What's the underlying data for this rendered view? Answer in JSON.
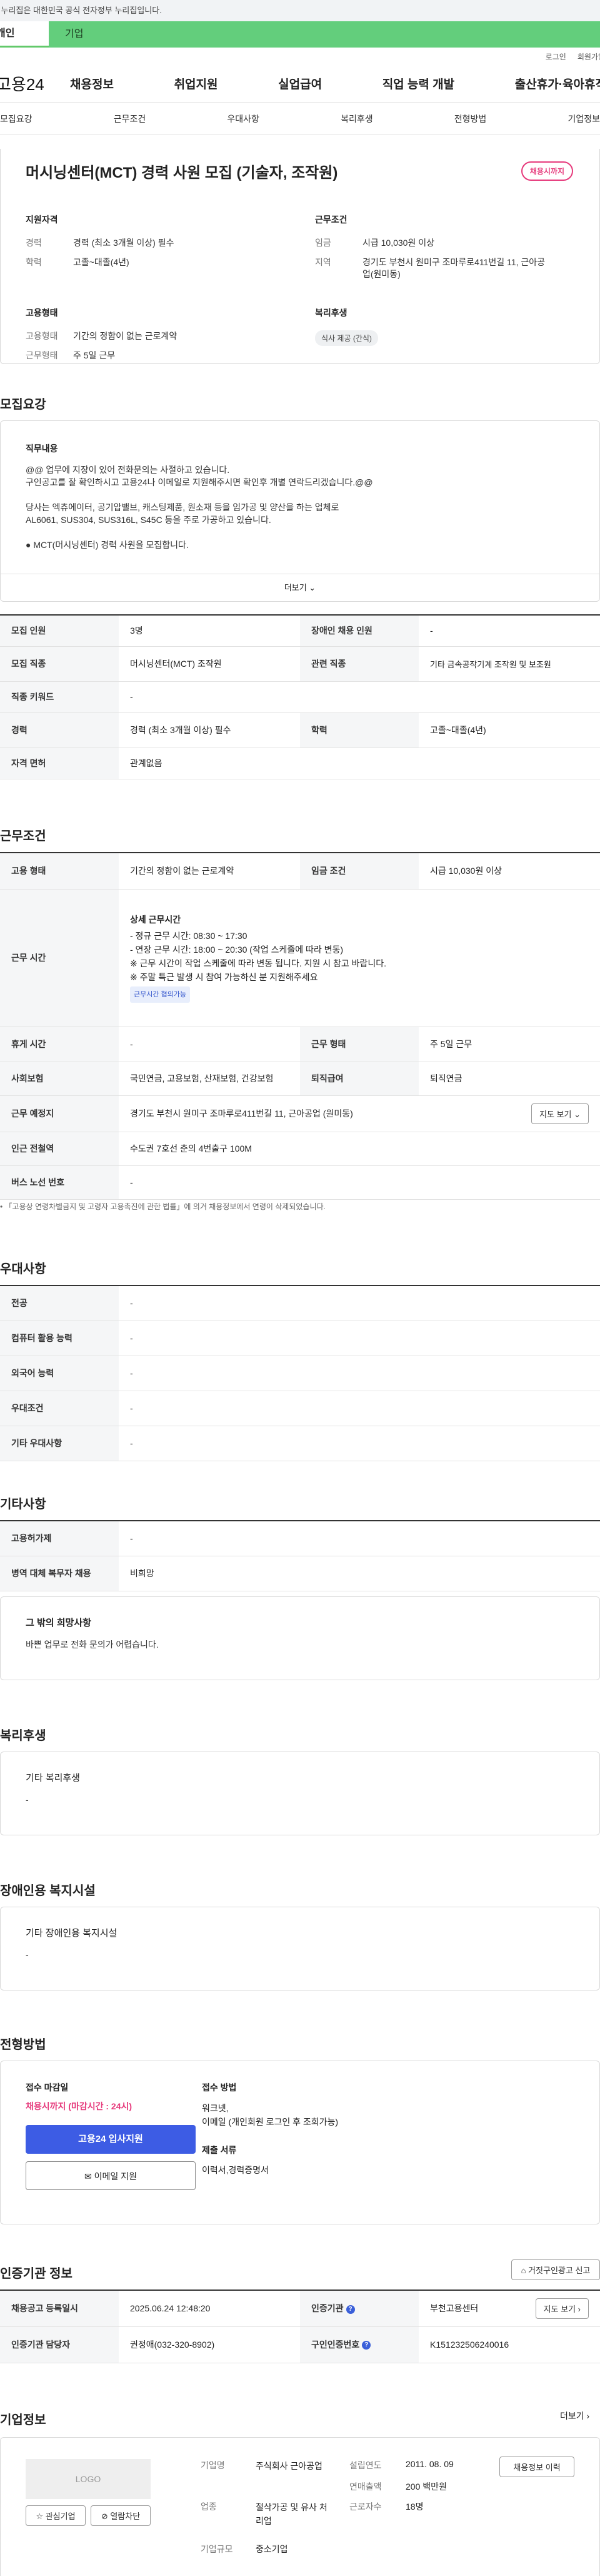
{
  "gov_banner": "이 누리집은 대한민국 공식 전자정부 누리집입니다.",
  "user_tabs": {
    "personal": "개인",
    "company": "기업"
  },
  "util": {
    "login": "로그인",
    "join": "회원가입"
  },
  "site": {
    "logo": "고용24"
  },
  "gnb": [
    "채용정보",
    "취업지원",
    "실업급여",
    "직업 능력 개발",
    "출산휴가·육아휴직"
  ],
  "anchors": [
    "모집요강",
    "근무조건",
    "우대사항",
    "복리후생",
    "전형방법",
    "기업정보"
  ],
  "job": {
    "title": "머시닝센터(MCT) 경력 사원 모집 (기술자, 조작원)",
    "status": "채용시까지",
    "qualification": {
      "heading": "지원자격",
      "career_label": "경력",
      "career": "경력 (최소 3개월 이상) 필수",
      "edu_label": "학력",
      "edu": "고졸~대졸(4년)"
    },
    "conditions": {
      "heading": "근무조건",
      "wage_label": "임금",
      "wage": "시급 10,030원 이상",
      "region_label": "지역",
      "region": "경기도 부천시 원미구 조마루로411번길 11, 근아공업(원미동)"
    },
    "employment": {
      "heading": "고용형태",
      "type_label": "고용형태",
      "type": "기간의 정함이 없는 근로계약",
      "schedule_label": "근무형태",
      "schedule": "주 5일 근무"
    },
    "welfare": {
      "heading": "복리후생",
      "chip": "식사 제공 (간식)"
    }
  },
  "recruit": {
    "heading": "모집요강",
    "duty_heading": "직무내용",
    "duty_lines": [
      "@@ 업무에 지장이 있어 전화문의는 사절하고 있습니다.",
      "구인공고를 잘 확인하시고 고용24나 이메일로 지원해주시면 확인후 개별 연락드리겠습니다.@@",
      "",
      "당사는 엑츄에이터, 공기압밸브, 캐스팅제품, 원소재 등을 임가공 및 양산을 하는 업체로",
      "AL6061, SUS304, SUS316L, S45C 등을 주로 가공하고 있습니다.",
      "",
      "● MCT(머시닝센터) 경력 사원을 모집합니다."
    ],
    "more": "더보기",
    "rows": [
      {
        "k1": "모집 인원",
        "v1": "3명",
        "k2": "장애인 채용 인원",
        "v2": "-"
      },
      {
        "k1": "모집 직종",
        "v1": "머시닝센터(MCT) 조작원",
        "k2": "관련 직종",
        "v2": "기타 금속공작기계 조작원 및 보조원"
      },
      {
        "k1": "직종 키워드",
        "v1": "-"
      },
      {
        "k1": "경력",
        "v1": "경력 (최소 3개월 이상) 필수",
        "k2": "학력",
        "v2": "고졸~대졸(4년)"
      },
      {
        "k1": "자격 면허",
        "v1": "관계없음"
      }
    ]
  },
  "work": {
    "heading": "근무조건",
    "type_k": "고용 형태",
    "type_v": "기간의 정함이 없는 근로계약",
    "wage_k": "임금 조건",
    "wage_v": "시급 10,030원 이상",
    "hours_k": "근무 시간",
    "hours_title": "상세 근무시간",
    "hours_lines": [
      "- 정규 근무 시간: 08:30 ~ 17:30",
      "- 연장 근무 시간: 18:00 ~ 20:30 (작업 스케줄에 따라 변동)",
      "※ 근무 시간이 작업 스케줄에 따라 변동 됩니다. 지원 시 참고 바랍니다.",
      "※ 주말 특근 발생 시 참여 가능하신 분 지원해주세요"
    ],
    "hours_badge": "근무시간 협의가능",
    "rest_k": "휴게 시간",
    "rest_v": "-",
    "form_k": "근무 형태",
    "form_v": "주 5일 근무",
    "ins_k": "사회보험",
    "ins_v": "국민연금, 고용보험, 산재보험, 건강보험",
    "ret_k": "퇴직급여",
    "ret_v": "퇴직연금",
    "place_k": "근무 예정지",
    "place_v": "경기도 부천시 원미구 조마루로411번길 11, 근아공업 (원미동)",
    "map_btn": "지도 보기",
    "subway_k": "인근 전철역",
    "subway_v": "수도권 7호선 춘의 4번출구 100M",
    "bus_k": "버스 노선 번호",
    "bus_v": "-",
    "note": "「고용상 연령차별금지 및 고령자 고용촉진에 관한 법률」에 의거 채용정보에서 연령이 삭제되었습니다."
  },
  "pref": {
    "heading": "우대사항",
    "rows": [
      {
        "k": "전공",
        "v": "-"
      },
      {
        "k": "컴퓨터 활용 능력",
        "v": "-"
      },
      {
        "k": "외국어 능력",
        "v": "-"
      },
      {
        "k": "우대조건",
        "v": "-"
      },
      {
        "k": "기타 우대사항",
        "v": "-"
      }
    ]
  },
  "etc": {
    "heading": "기타사항",
    "rows": [
      {
        "k": "고용허가제",
        "v": "-"
      },
      {
        "k": "병역 대체 복무자 채용",
        "v": "비희망"
      }
    ],
    "wish_heading": "그 밖의 희망사항",
    "wish": "바쁜 업무로 전화 문의가 어렵습니다."
  },
  "benefits": {
    "heading": "복리후생",
    "sub": "기타 복리후생",
    "value": "-"
  },
  "disability": {
    "heading": "장애인용 복지시설",
    "sub": "기타 장애인용 복지시설",
    "value": "-"
  },
  "process": {
    "heading": "전형방법",
    "deadline_label": "접수 마감일",
    "deadline": "채용시까지 (마감시간 : 24시)",
    "apply_btn": "고용24 입사지원",
    "email_btn": "이메일 지원",
    "method_label": "접수 방법",
    "method_1": "워크넷,",
    "method_2": "이메일 (개인회원 로그인 후 조회가능)",
    "docs_label": "제출 서류",
    "docs": "이력서,경력증명서"
  },
  "cert": {
    "heading": "인증기관 정보",
    "report_btn": "거짓구인광고 신고",
    "reg_k": "채용공고 등록일시",
    "reg_v": "2025.06.24 12:48:20",
    "org_k": "인증기관",
    "org_v": "부천고용센터",
    "map_btn": "지도 보기",
    "mgr_k": "인증기관 담당자",
    "mgr_v": "권정애(032-320-8902)",
    "no_k": "구인인증번호",
    "no_v": "K151232506240016"
  },
  "company": {
    "heading": "기업정보",
    "more": "더보기",
    "logo": "LOGO",
    "fav_btn": "관심기업",
    "block_btn": "열람차단",
    "name_k": "기업명",
    "name_v": "주식회사 근아공업",
    "found_k": "설립연도",
    "found_v": "2011. 08. 09",
    "industry_k": "업종",
    "industry_v": "절삭가공 및 유사 처리업",
    "sales_k": "연매출액",
    "sales_v": "200 백만원",
    "emp_k": "근로자수",
    "emp_v": "18명",
    "size_k": "기업규모",
    "size_v": "중소기업",
    "jobs_btn": "채용정보 이력"
  }
}
